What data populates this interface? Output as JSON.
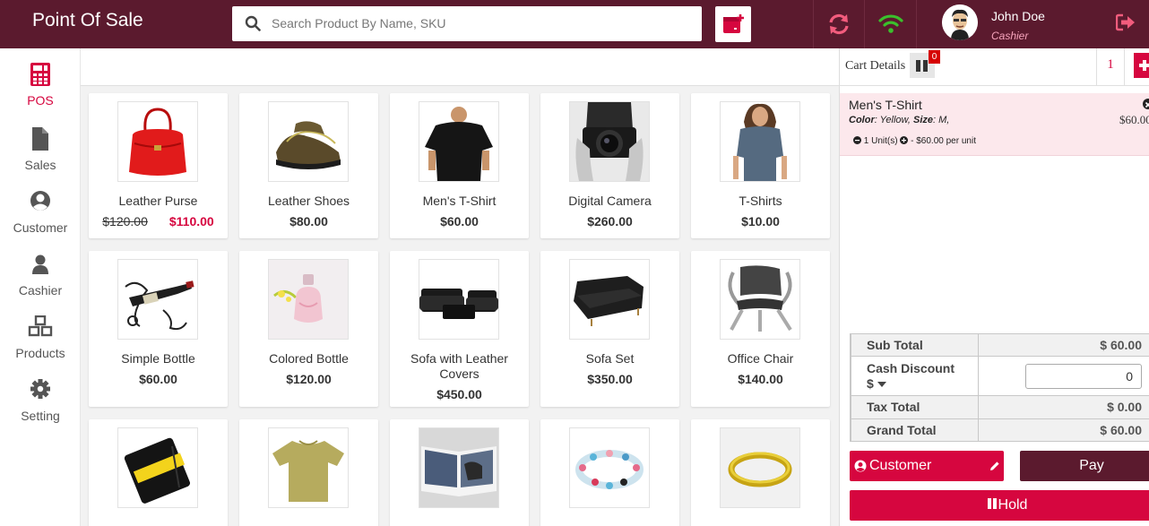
{
  "header": {
    "app_title": "Point Of Sale",
    "search_placeholder": "Search Product By Name, SKU",
    "user_name": "John Doe",
    "user_role": "Cashier",
    "brand_color": "#5b1a2e",
    "accent_color": "#d6063f"
  },
  "sidebar": {
    "items": [
      {
        "label": "POS",
        "icon": "calculator-icon",
        "active": true
      },
      {
        "label": "Sales",
        "icon": "file-icon"
      },
      {
        "label": "Customer",
        "icon": "user-circle-icon"
      },
      {
        "label": "Cashier",
        "icon": "user-icon"
      },
      {
        "label": "Products",
        "icon": "cubes-icon"
      },
      {
        "label": "Setting",
        "icon": "gear-icon"
      }
    ]
  },
  "products": [
    {
      "name": "Leather Purse",
      "old_price": "$120.00",
      "price": "$110.00"
    },
    {
      "name": "Leather Shoes",
      "price": "$80.00"
    },
    {
      "name": "Men's T-Shirt",
      "price": "$60.00"
    },
    {
      "name": "Digital Camera",
      "price": "$260.00"
    },
    {
      "name": "T-Shirts",
      "price": "$10.00"
    },
    {
      "name": "Simple Bottle",
      "price": "$60.00"
    },
    {
      "name": "Colored Bottle",
      "price": "$120.00"
    },
    {
      "name": "Sofa with Leather Covers",
      "price": "$450.00"
    },
    {
      "name": "Sofa Set",
      "price": "$350.00"
    },
    {
      "name": "Office Chair",
      "price": "$140.00"
    },
    {
      "name": "",
      "price": ""
    },
    {
      "name": "",
      "price": ""
    },
    {
      "name": "",
      "price": ""
    },
    {
      "name": "",
      "price": ""
    },
    {
      "name": "",
      "price": ""
    }
  ],
  "cart": {
    "title": "Cart Details",
    "held_count": "0",
    "tab_number": "1",
    "items": [
      {
        "name": "Men's T-Shirt",
        "color_label": "Color",
        "color": "Yellow",
        "size_label": "Size",
        "size": "M,",
        "price": "$60.00",
        "qty_text": "1 Unit(s)",
        "unit_price_text": "- $60.00 per unit"
      }
    ],
    "totals": {
      "sub_total_label": "Sub Total",
      "sub_total": "$ 60.00",
      "discount_label": "Cash Discount",
      "discount_currency": "$",
      "discount_value": "0",
      "tax_label": "Tax Total",
      "tax": "$ 0.00",
      "grand_label": "Grand Total",
      "grand": "$ 60.00"
    },
    "buttons": {
      "customer": "Customer",
      "pay": "Pay",
      "hold": "Hold"
    }
  }
}
